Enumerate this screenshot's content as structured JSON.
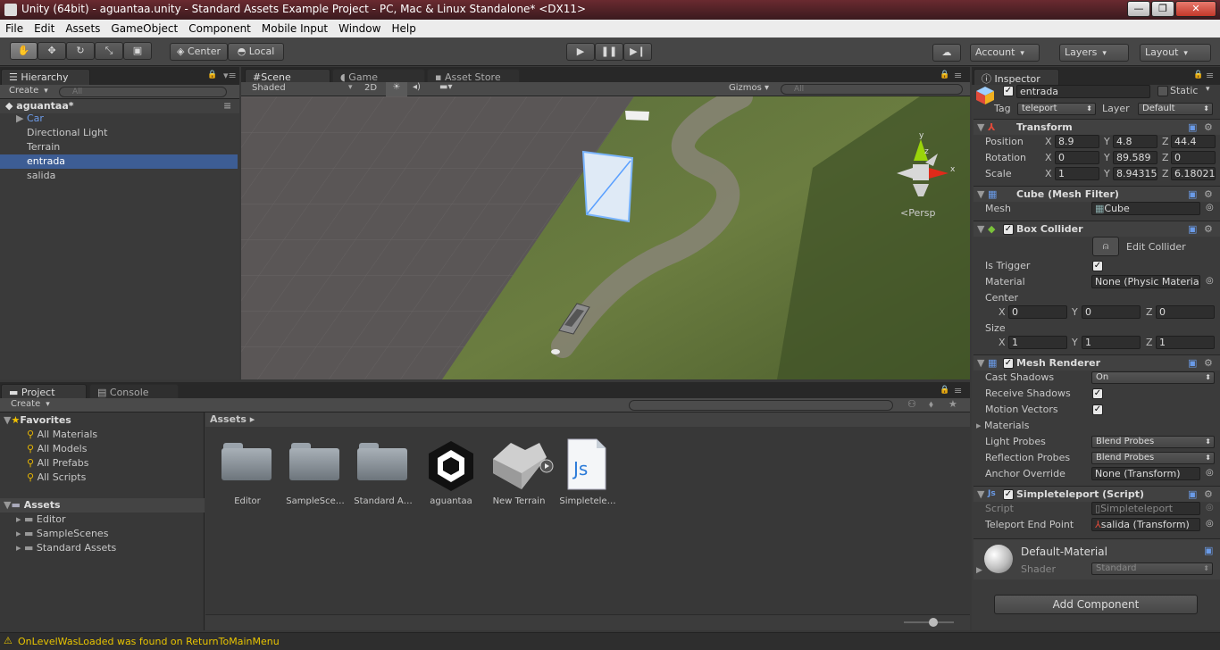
{
  "window": {
    "title": "Unity (64bit) - aguantaa.unity - Standard Assets Example Project - PC, Mac & Linux Standalone* <DX11>",
    "controls": {
      "minimize": "—",
      "maximize": "❐",
      "close": "✕"
    }
  },
  "menu": [
    "File",
    "Edit",
    "Assets",
    "GameObject",
    "Component",
    "Mobile Input",
    "Window",
    "Help"
  ],
  "toolbar": {
    "pivot": "Center",
    "space": "Local",
    "account": "Account",
    "layers": "Layers",
    "layout": "Layout"
  },
  "hierarchy": {
    "tab": "Hierarchy",
    "create": "Create",
    "search_placeholder": "All",
    "scene": "aguantaa*",
    "items": [
      {
        "label": "Car",
        "color": "#6d9be8"
      },
      {
        "label": "Directional Light"
      },
      {
        "label": "Terrain"
      },
      {
        "label": "entrada",
        "selected": true
      },
      {
        "label": "salida"
      }
    ]
  },
  "scene_view": {
    "tabs": [
      "Scene",
      "Game",
      "Asset Store"
    ],
    "shading": "Shaded",
    "mode_2d": "2D",
    "gizmos": "Gizmos",
    "search_placeholder": "All",
    "persp": "<Persp",
    "axes": {
      "y": "y",
      "z": "z",
      "x": "x"
    }
  },
  "project": {
    "tabs": [
      "Project",
      "Console"
    ],
    "create": "Create",
    "favorites_title": "Favorites",
    "favorites": [
      "All Materials",
      "All Models",
      "All Prefabs",
      "All Scripts"
    ],
    "assets_title": "Assets",
    "asset_folders": [
      "Editor",
      "SampleScenes",
      "Standard Assets"
    ],
    "breadcrumb": "Assets ▸",
    "assets": [
      {
        "label": "Editor",
        "kind": "folder"
      },
      {
        "label": "SampleSce…",
        "kind": "folder"
      },
      {
        "label": "Standard A…",
        "kind": "folder"
      },
      {
        "label": "aguantaa",
        "kind": "unity-scene"
      },
      {
        "label": "New Terrain",
        "kind": "terrain"
      },
      {
        "label": "Simpletele…",
        "kind": "js-script"
      }
    ]
  },
  "inspector": {
    "tab": "Inspector",
    "object_name": "entrada",
    "static_label": "Static",
    "tag_label": "Tag",
    "tag_value": "teleport",
    "layer_label": "Layer",
    "layer_value": "Default",
    "transform": {
      "title": "Transform",
      "position_label": "Position",
      "rotation_label": "Rotation",
      "scale_label": "Scale",
      "position": {
        "x": "8.9",
        "y": "4.8",
        "z": "44.4"
      },
      "rotation": {
        "x": "0",
        "y": "89.589",
        "z": "0"
      },
      "scale": {
        "x": "1",
        "y": "8.94315",
        "z": "6.18021"
      }
    },
    "mesh_filter": {
      "title": "Cube (Mesh Filter)",
      "mesh_label": "Mesh",
      "mesh_value": "Cube"
    },
    "box_collider": {
      "title": "Box Collider",
      "edit_collider": "Edit Collider",
      "is_trigger_label": "Is Trigger",
      "material_label": "Material",
      "material_value": "None (Physic Materia",
      "center_label": "Center",
      "center": {
        "x": "0",
        "y": "0",
        "z": "0"
      },
      "size_label": "Size",
      "size": {
        "x": "1",
        "y": "1",
        "z": "1"
      }
    },
    "mesh_renderer": {
      "title": "Mesh Renderer",
      "cast_shadows_label": "Cast Shadows",
      "cast_shadows_value": "On",
      "receive_shadows_label": "Receive Shadows",
      "motion_vectors_label": "Motion Vectors",
      "materials_label": "Materials",
      "light_probes_label": "Light Probes",
      "light_probes_value": "Blend Probes",
      "reflection_probes_label": "Reflection Probes",
      "reflection_probes_value": "Blend Probes",
      "anchor_override_label": "Anchor Override",
      "anchor_override_value": "None (Transform)"
    },
    "script": {
      "title": "Simpleteleport (Script)",
      "script_label": "Script",
      "script_value": "Simpleteleport",
      "teleport_end_label": "Teleport End Point",
      "teleport_end_value": "salida (Transform)"
    },
    "material": {
      "name": "Default-Material",
      "shader_label": "Shader",
      "shader_value": "Standard"
    },
    "add_component": "Add Component"
  },
  "status": {
    "message": "OnLevelWasLoaded was found on ReturnToMainMenu",
    "color": "#e8c400"
  }
}
